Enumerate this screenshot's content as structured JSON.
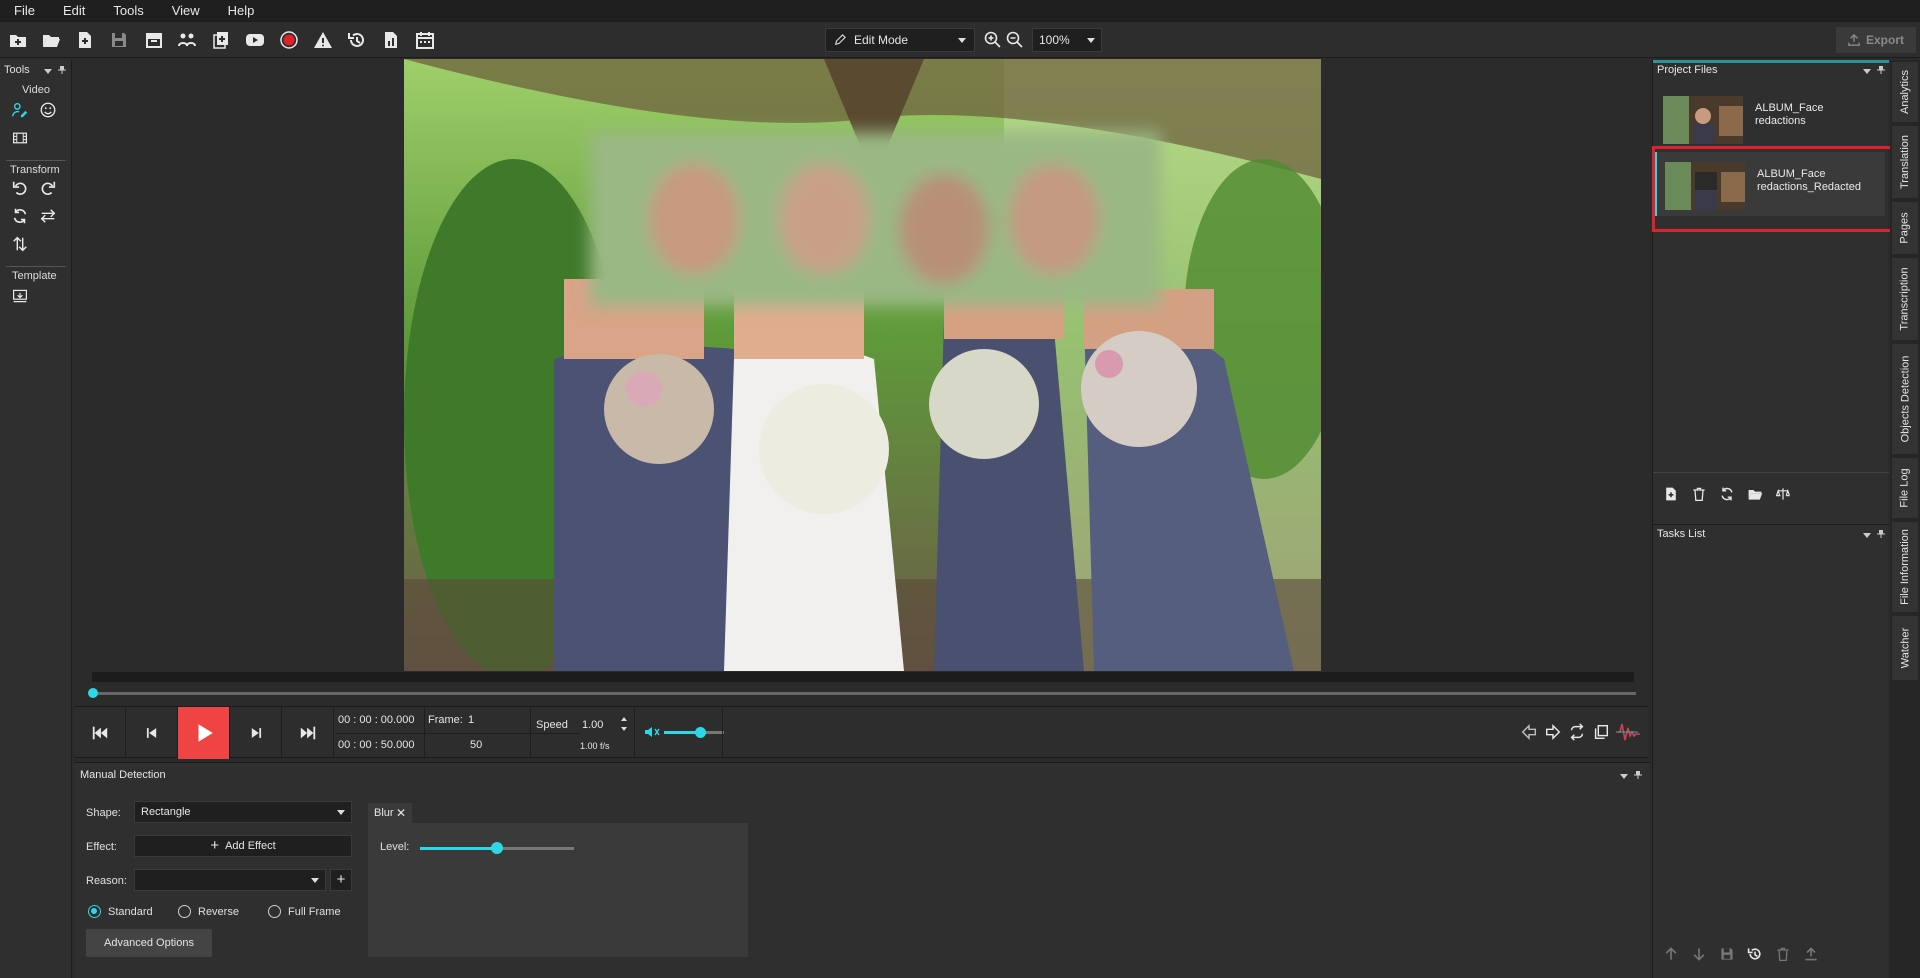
{
  "menu": [
    "File",
    "Edit",
    "Tools",
    "View",
    "Help"
  ],
  "toolbar": {
    "mode_label": "Edit Mode",
    "zoom_value": "100%",
    "export_label": "Export"
  },
  "tools_panel": {
    "title": "Tools",
    "sections": {
      "video": "Video",
      "transform": "Transform",
      "template": "Template"
    }
  },
  "transport": {
    "time_current": "00 : 00 : 00.000",
    "time_total": "00 : 00 : 50.000",
    "frame_label": "Frame:",
    "frame_value": "1",
    "frame_total": "50",
    "speed_label": "Speed",
    "speed_value": "1.00",
    "fps": "1.00 f/s",
    "volume_level": 0.6
  },
  "manual_detection": {
    "title": "Manual Detection",
    "shape_label": "Shape:",
    "shape_value": "Rectangle",
    "effect_label": "Effect:",
    "add_effect_label": "Add Effect",
    "reason_label": "Reason:",
    "reason_value": "",
    "radios": [
      {
        "label": "Standard",
        "checked": true
      },
      {
        "label": "Reverse",
        "checked": false
      },
      {
        "label": "Full Frame",
        "checked": false
      }
    ],
    "advanced_label": "Advanced Options",
    "effect_tab": "Blur",
    "level_label": "Level:",
    "level_value": 0.5
  },
  "project_files": {
    "title": "Project Files",
    "files": [
      {
        "line1": "ALBUM_Face",
        "line2": "redactions",
        "selected": false
      },
      {
        "line1": "ALBUM_Face",
        "line2": "redactions_Redacted",
        "selected": true
      }
    ]
  },
  "tasks": {
    "title": "Tasks List"
  },
  "side_tabs": [
    "Analytics",
    "Translation",
    "Pages",
    "Transcription",
    "Objects Detection",
    "File Log",
    "File Information",
    "Watcher"
  ],
  "colors": {
    "accent": "#2fd7e6",
    "play": "#f04343",
    "highlight_border": "#e0202a"
  }
}
